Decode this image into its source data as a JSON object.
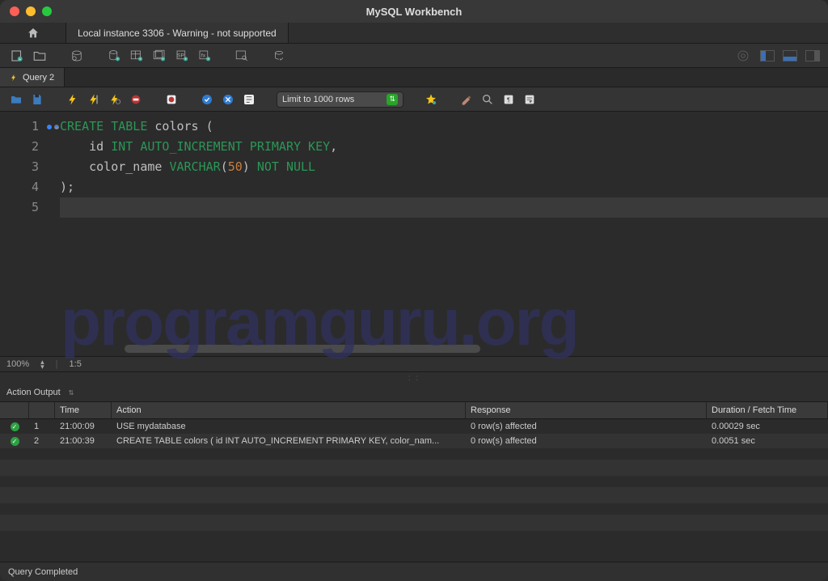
{
  "window": {
    "title": "MySQL Workbench"
  },
  "connection_tab": "Local instance 3306 - Warning - not supported",
  "query_tab": "Query 2",
  "limit_label": "Limit to 1000 rows",
  "editor": {
    "lines": [
      "1",
      "2",
      "3",
      "4",
      "5"
    ],
    "zoom": "100%",
    "pos": "1:5"
  },
  "code": {
    "l1_kw1": "CREATE",
    "l1_kw2": "TABLE",
    "l1_ident": "colors",
    "l1_paren": "(",
    "l2_indent": "    ",
    "l2_id": "id",
    "l2_rest": "INT AUTO_INCREMENT PRIMARY KEY",
    "l2_comma": ",",
    "l3_indent": "    ",
    "l3_col": "color_name",
    "l3_type": "VARCHAR",
    "l3_open": "(",
    "l3_num": "50",
    "l3_close": ")",
    "l3_notnull": "NOT NULL",
    "l4": ");"
  },
  "watermark": "programguru.org",
  "output": {
    "dropdown": "Action Output",
    "cols": {
      "time": "Time",
      "action": "Action",
      "response": "Response",
      "duration": "Duration / Fetch Time"
    },
    "rows": [
      {
        "n": "1",
        "time": "21:00:09",
        "action": "USE mydatabase",
        "response": "0 row(s) affected",
        "duration": "0.00029 sec"
      },
      {
        "n": "2",
        "time": "21:00:39",
        "action": "CREATE TABLE colors (     id INT AUTO_INCREMENT PRIMARY KEY,     color_nam...",
        "response": "0 row(s) affected",
        "duration": "0.0051 sec"
      }
    ]
  },
  "status": "Query Completed"
}
